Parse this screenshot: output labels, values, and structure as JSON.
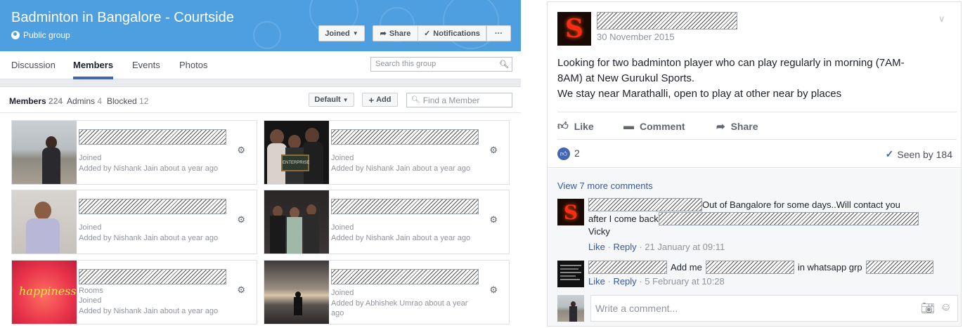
{
  "group": {
    "title": "Badminton in Bangalore - Courtside",
    "privacy": "Public group",
    "buttons": {
      "joined": "Joined",
      "share": "Share",
      "notifications": "Notifications",
      "more": "···"
    }
  },
  "tabs": [
    "Discussion",
    "Members",
    "Events",
    "Photos"
  ],
  "search_placeholder": "Search this group",
  "members_header": {
    "members_label": "Members",
    "members_count": "224",
    "admins_label": "Admins",
    "admins_count": "4",
    "blocked_label": "Blocked",
    "blocked_count": "12",
    "sort_button": "Default",
    "add_button": "Add",
    "find_placeholder": "Find a Member"
  },
  "members": [
    {
      "extra": "",
      "status": "Joined",
      "added": "Added by Nishank Jain about a year ago"
    },
    {
      "extra": "",
      "status": "Joined",
      "added": "Added by Nishank Jain about a year ago"
    },
    {
      "extra": "",
      "status": "Joined",
      "added": "Added by Nishank Jain about a year ago"
    },
    {
      "extra": "",
      "status": "Joined",
      "added": "Added by Nishank Jain about a year ago"
    },
    {
      "extra": "Rooms",
      "status": "Joined",
      "added": "Added by Nishank Jain about a year ago"
    },
    {
      "extra": "",
      "status": "Joined",
      "added": "Added by Abhishek Umrao about a year ago"
    }
  ],
  "member_photo_text": {
    "chalkboard": "ENTERPRISE",
    "happiness": "happiness"
  },
  "post": {
    "date": "30 November 2015",
    "body": [
      "Looking for two badminton player who can play regularly in morning (7AM-",
      "8AM) at New Gurukul Sports.",
      "We stay near Marathalli, open to play at other near by places"
    ],
    "actions": {
      "like": "Like",
      "comment": "Comment",
      "share": "Share"
    },
    "like_count": "2",
    "seen_by": "Seen by 184",
    "view_more": "View 7 more comments",
    "avatar_letter": "S"
  },
  "comments": [
    {
      "line1": "Out of Bangalore for some days..Will contact you",
      "line2": "after I come back",
      "line3": "Vicky",
      "like": "Like",
      "reply": "Reply",
      "time": "21 January at 09:11",
      "avatar_letter": "S"
    },
    {
      "part1": "Add me",
      "part2": "in whatsapp grp",
      "like": "Like",
      "reply": "Reply",
      "time": "5 February at 10:28"
    }
  ],
  "composer_placeholder": "Write a comment..."
}
